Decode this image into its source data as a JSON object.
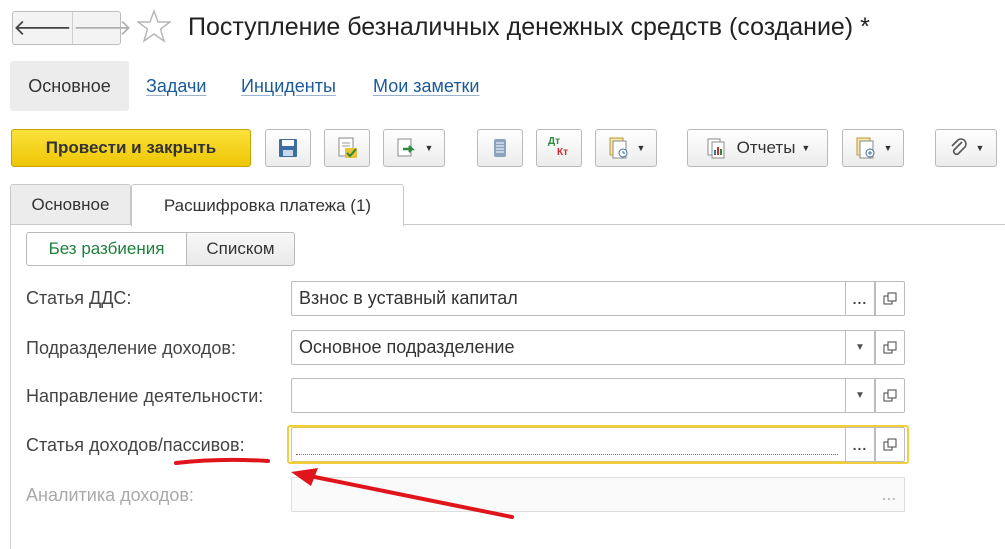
{
  "window": {
    "title": "Поступление безналичных денежных средств (создание) *",
    "back_icon": "arrow-left-icon",
    "forward_icon": "arrow-right-icon",
    "favorite_icon": "star-icon"
  },
  "sections": {
    "active": "Основное",
    "links": [
      "Задачи",
      "Инциденты",
      "Мои заметки"
    ]
  },
  "toolbar": {
    "post_close_label": "Провести и закрыть",
    "reports_label": "Отчеты",
    "icons": [
      "save-icon",
      "post-icon",
      "create-based-icon",
      "journal-icon",
      "dt-kt-icon",
      "documents-icon",
      "reports-icon",
      "print-icon",
      "attach-icon"
    ],
    "dt_label": "Дт",
    "kt_label": "Кт"
  },
  "tabs": {
    "main": "Основное",
    "payment": "Расшифровка платежа (1)"
  },
  "mode_toggle": {
    "single": "Без разбиения",
    "list": "Списком"
  },
  "form": {
    "dds_article": {
      "label": "Статья ДДС:",
      "value": "Взнос в уставный капитал"
    },
    "income_department": {
      "label": "Подразделение доходов:",
      "value": "Основное подразделение"
    },
    "activity_direction": {
      "label": "Направление деятельности:",
      "value": ""
    },
    "income_article": {
      "label": "Статья доходов/пассивов:",
      "value": ""
    },
    "income_analytics": {
      "label": "Аналитика доходов:",
      "value": ""
    }
  },
  "colors": {
    "primary_button": "#f5d21b",
    "link": "#1a5a9a",
    "toggle_active": "#1e7f3e",
    "focus": "#f2cf3a",
    "annotation": "#e0151b"
  }
}
